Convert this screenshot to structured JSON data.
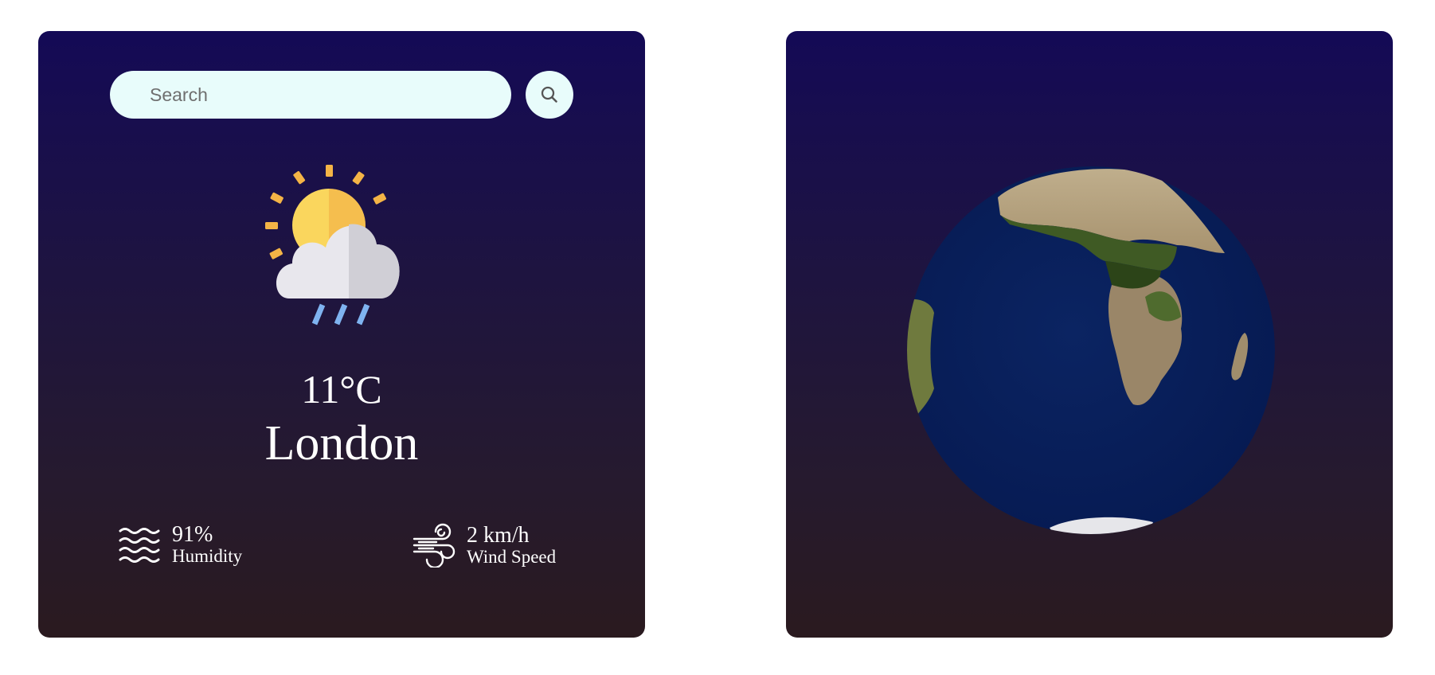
{
  "search": {
    "placeholder": "Search",
    "value": ""
  },
  "weather": {
    "icon": "sun-cloud-rain-icon",
    "temperature": "11°C",
    "city": "London"
  },
  "stats": {
    "humidity": {
      "value": "91%",
      "label": "Humidity",
      "icon": "humidity-waves-icon"
    },
    "wind": {
      "value": "2 km/h",
      "label": "Wind Speed",
      "icon": "wind-icon"
    }
  },
  "colors": {
    "card_top": "#140a56",
    "card_bottom": "#2a1a1f",
    "input_bg": "#e8fcfb",
    "text": "#ffffff"
  },
  "globe": {
    "icon": "earth-globe-icon"
  }
}
